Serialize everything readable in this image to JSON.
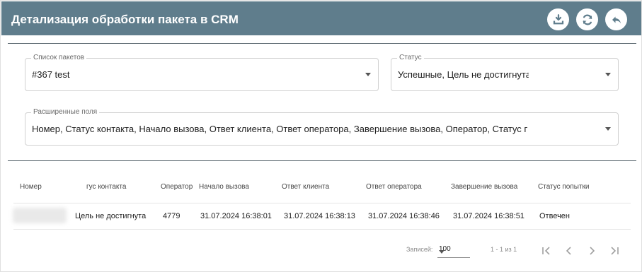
{
  "header": {
    "title": "Детализация обработки пакета в CRM",
    "buttons": [
      {
        "name": "download-icon"
      },
      {
        "name": "refresh-icon"
      },
      {
        "name": "reply-icon"
      }
    ]
  },
  "filters": {
    "packages": {
      "label": "Список пакетов",
      "value": "#367 test"
    },
    "status": {
      "label": "Статус",
      "value": "Успешные, Цель не достигнута"
    },
    "fields": {
      "label": "Расширенные поля",
      "value": "Номер, Статус контакта, Начало вызова, Ответ клиента, Ответ оператора, Завершение вызова, Оператор, Статус попытки"
    }
  },
  "table": {
    "columns": [
      "Номер",
      "гус контакта",
      "Оператор",
      "Начало вызова",
      "Ответ клиента",
      "Ответ оператора",
      "Завершение вызова",
      "Статус попытки"
    ],
    "rows": [
      {
        "number": "",
        "contact_status": "Цель не достигнута",
        "operator": "4779",
        "call_start": "31.07.2024 16:38:01",
        "client_answer": "31.07.2024 16:38:13",
        "operator_answer": "31.07.2024 16:38:46",
        "call_end": "31.07.2024 16:38:51",
        "attempt_status": "Отвечен"
      }
    ]
  },
  "pagination": {
    "rows_label": "Записей:",
    "rows_value": "100",
    "range": "1 - 1 из 1"
  },
  "colors": {
    "header_bg": "#5f7d8c",
    "header_text": "#ffffff"
  }
}
